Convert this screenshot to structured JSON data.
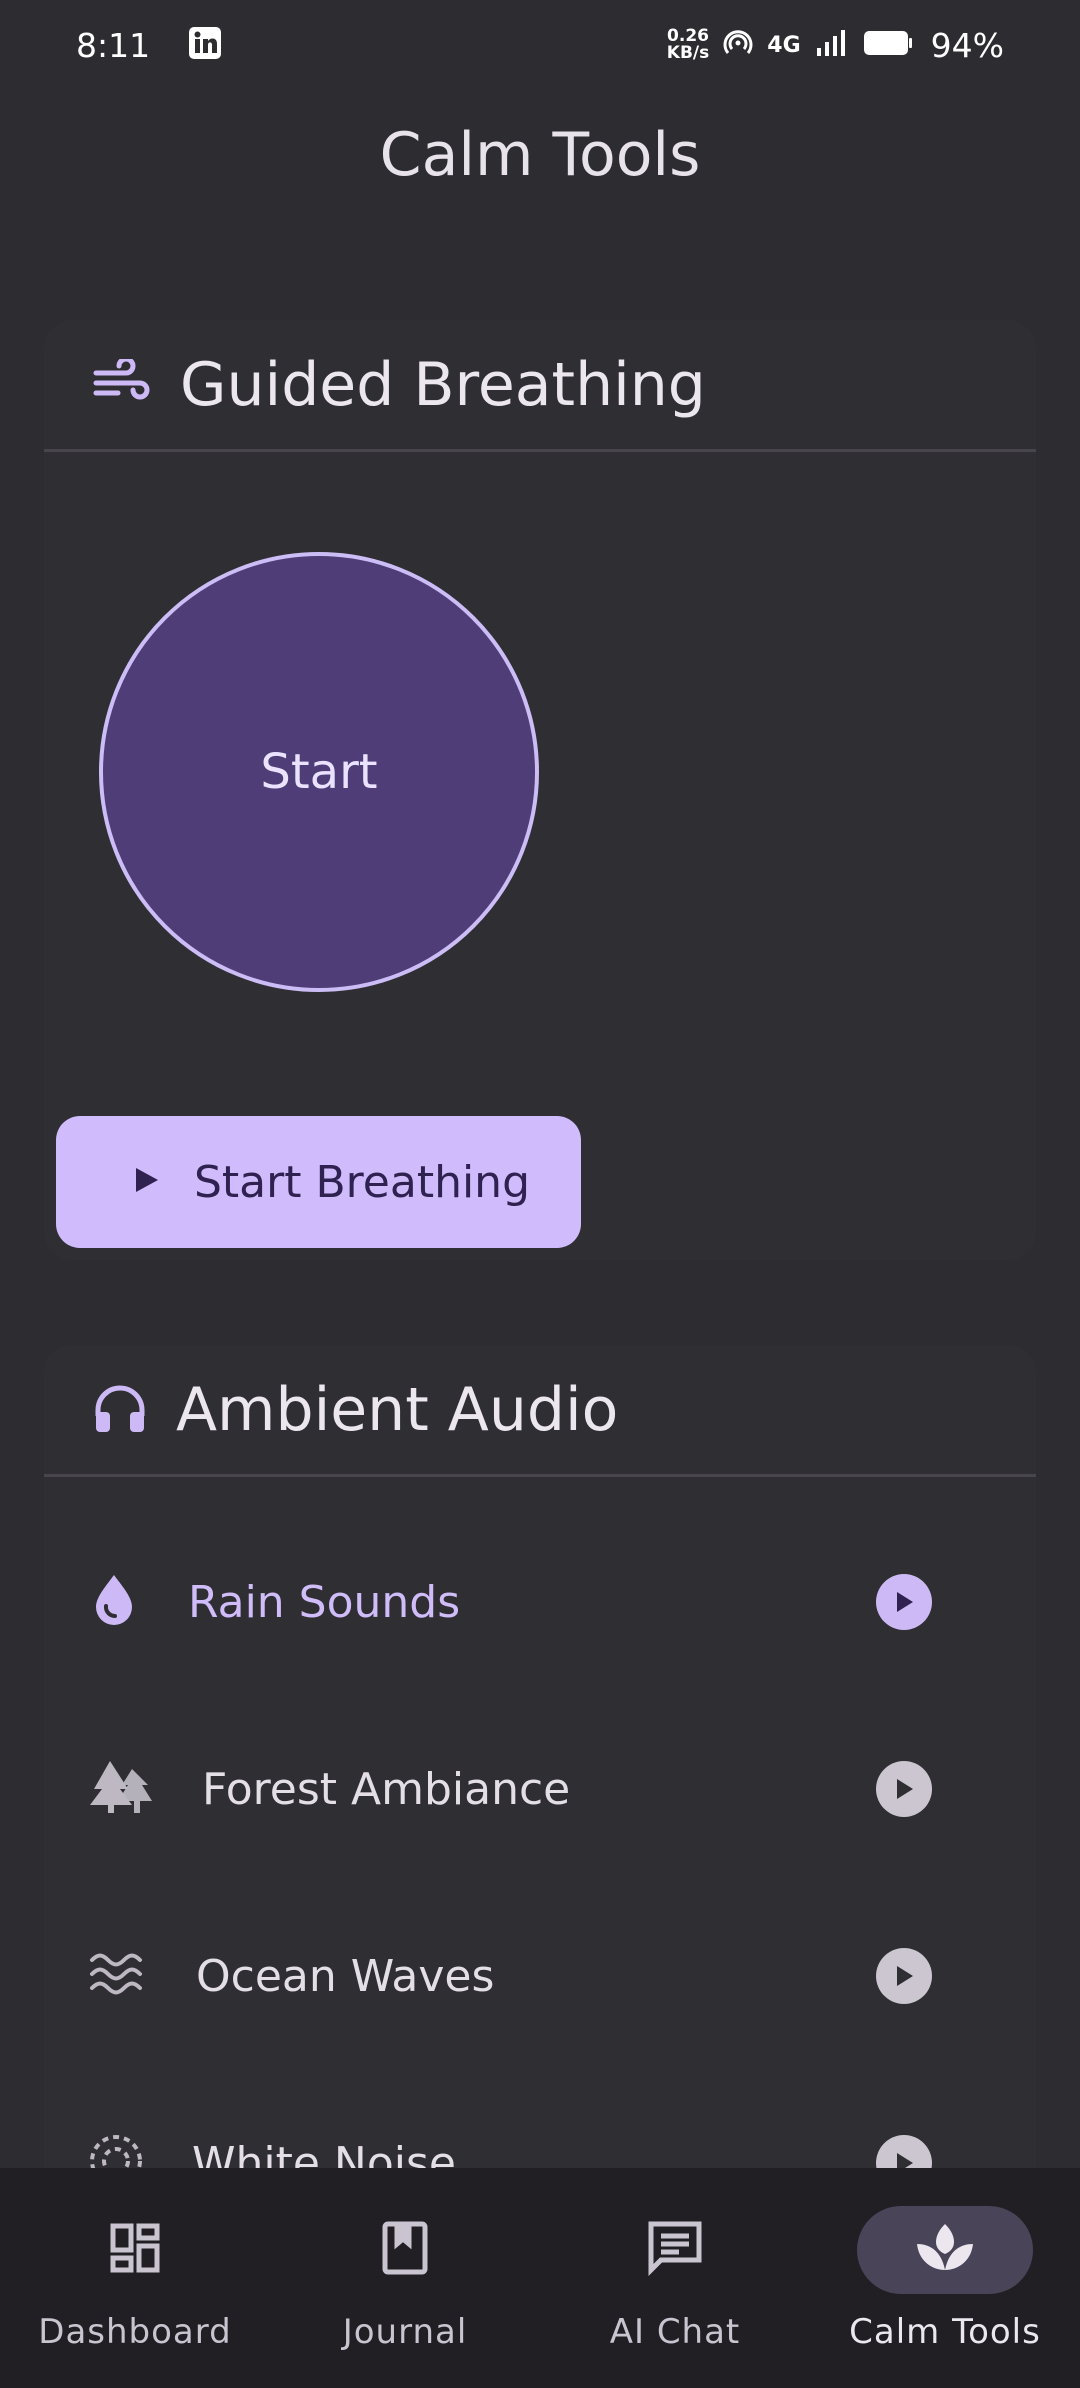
{
  "status_bar": {
    "time": "8:11",
    "net_speed_value": "0.26",
    "net_speed_unit": "KB/s",
    "network": "4G",
    "battery": "94%"
  },
  "page": {
    "title": "Calm Tools"
  },
  "breathing": {
    "title": "Guided Breathing",
    "circle_label": "Start",
    "button_label": "Start Breathing"
  },
  "audio": {
    "title": "Ambient Audio",
    "tracks": [
      {
        "label": "Rain Sounds",
        "icon": "water-drop-icon",
        "active": true
      },
      {
        "label": "Forest Ambiance",
        "icon": "forest-icon",
        "active": false
      },
      {
        "label": "Ocean Waves",
        "icon": "waves-icon",
        "active": false
      },
      {
        "label": "White Noise",
        "icon": "noise-icon",
        "active": false
      }
    ]
  },
  "nav": {
    "items": [
      {
        "label": "Dashboard",
        "icon": "dashboard-icon"
      },
      {
        "label": "Journal",
        "icon": "journal-icon"
      },
      {
        "label": "AI Chat",
        "icon": "chat-icon"
      },
      {
        "label": "Calm Tools",
        "icon": "spa-icon"
      }
    ],
    "active": "Calm Tools"
  },
  "colors": {
    "accent": "#d0bcfc",
    "background": "#2d2c31",
    "nav_background": "#211f24"
  }
}
